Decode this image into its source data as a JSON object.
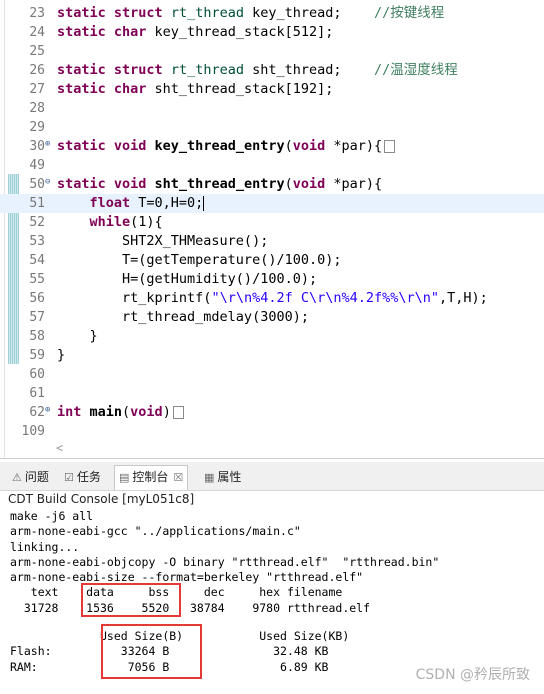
{
  "editor": {
    "lines": [
      {
        "n": "23",
        "parts": [
          {
            "t": "static ",
            "c": "kw"
          },
          {
            "t": "struct ",
            "c": "kw"
          },
          {
            "t": "rt_thread",
            "c": "ty"
          },
          {
            "t": " key_thread;    ",
            "c": ""
          },
          {
            "t": "//按键线程",
            "c": "cm"
          }
        ]
      },
      {
        "n": "24",
        "parts": [
          {
            "t": "static ",
            "c": "kw"
          },
          {
            "t": "char",
            "c": "kw"
          },
          {
            "t": " key_thread_stack[512];",
            "c": ""
          }
        ]
      },
      {
        "n": "25",
        "parts": []
      },
      {
        "n": "26",
        "parts": [
          {
            "t": "static ",
            "c": "kw"
          },
          {
            "t": "struct ",
            "c": "kw"
          },
          {
            "t": "rt_thread",
            "c": "ty"
          },
          {
            "t": " sht_thread;    ",
            "c": ""
          },
          {
            "t": "//温湿度线程",
            "c": "cm"
          }
        ]
      },
      {
        "n": "27",
        "parts": [
          {
            "t": "static ",
            "c": "kw"
          },
          {
            "t": "char",
            "c": "kw"
          },
          {
            "t": " sht_thread_stack[192];",
            "c": ""
          }
        ]
      },
      {
        "n": "28",
        "parts": []
      },
      {
        "n": "29",
        "parts": []
      },
      {
        "n": "30",
        "fold": "⊕",
        "collapsed": true,
        "parts": [
          {
            "t": "static ",
            "c": "kw"
          },
          {
            "t": "void ",
            "c": "kw"
          },
          {
            "t": "key_thread_entry",
            "c": "b"
          },
          {
            "t": "(",
            "c": ""
          },
          {
            "t": "void",
            "c": "kw"
          },
          {
            "t": " *par){",
            "c": ""
          }
        ]
      },
      {
        "n": "49",
        "parts": []
      },
      {
        "n": "50",
        "fold": "⊖",
        "parts": [
          {
            "t": "static ",
            "c": "kw"
          },
          {
            "t": "void ",
            "c": "kw"
          },
          {
            "t": "sht_thread_entry",
            "c": "b"
          },
          {
            "t": "(",
            "c": ""
          },
          {
            "t": "void",
            "c": "kw"
          },
          {
            "t": " *par){",
            "c": ""
          }
        ]
      },
      {
        "n": "51",
        "current": true,
        "caret": true,
        "parts": [
          {
            "t": "    ",
            "c": ""
          },
          {
            "t": "float",
            "c": "kw"
          },
          {
            "t": " T=0,H=0;",
            "c": ""
          }
        ]
      },
      {
        "n": "52",
        "parts": [
          {
            "t": "    ",
            "c": ""
          },
          {
            "t": "while",
            "c": "kw"
          },
          {
            "t": "(1){",
            "c": ""
          }
        ]
      },
      {
        "n": "53",
        "parts": [
          {
            "t": "        SHT2X_THMeasure();",
            "c": ""
          }
        ]
      },
      {
        "n": "54",
        "parts": [
          {
            "t": "        T=(getTemperature()/100.0);",
            "c": ""
          }
        ]
      },
      {
        "n": "55",
        "parts": [
          {
            "t": "        H=(getHumidity()/100.0);",
            "c": ""
          }
        ]
      },
      {
        "n": "56",
        "parts": [
          {
            "t": "        rt_kprintf(",
            "c": ""
          },
          {
            "t": "\"\\r\\n%4.2f C\\r\\n%4.2f%%\\r\\n\"",
            "c": "st"
          },
          {
            "t": ",T,H);",
            "c": ""
          }
        ]
      },
      {
        "n": "57",
        "parts": [
          {
            "t": "        rt_thread_mdelay(3000);",
            "c": ""
          }
        ]
      },
      {
        "n": "58",
        "parts": [
          {
            "t": "    }",
            "c": ""
          }
        ]
      },
      {
        "n": "59",
        "parts": [
          {
            "t": "}",
            "c": ""
          }
        ]
      },
      {
        "n": "60",
        "parts": []
      },
      {
        "n": "61",
        "parts": []
      },
      {
        "n": "62",
        "fold": "⊕",
        "collapsed": true,
        "parts": [
          {
            "t": "int ",
            "c": "kw"
          },
          {
            "t": "main",
            "c": "b"
          },
          {
            "t": "(",
            "c": ""
          },
          {
            "t": "void",
            "c": "kw"
          },
          {
            "t": ")",
            "c": ""
          }
        ]
      },
      {
        "n": "109",
        "parts": []
      }
    ],
    "hscroll_glyph": "<"
  },
  "panel": {
    "tabs": [
      {
        "label": "问题",
        "icon": "problems-icon",
        "glyph": "⚠"
      },
      {
        "label": "任务",
        "icon": "tasks-icon",
        "glyph": "☑"
      },
      {
        "label": "控制台",
        "icon": "console-icon",
        "glyph": "▤",
        "close": "☒"
      },
      {
        "label": "属性",
        "icon": "properties-icon",
        "glyph": "▦"
      }
    ],
    "console_title": "CDT Build Console [myL051c8]",
    "console_lines": [
      "make -j6 all",
      "arm-none-eabi-gcc \"../applications/main.c\"",
      "linking...",
      "arm-none-eabi-objcopy -O binary \"rtthread.elf\"  \"rtthread.bin\"",
      "arm-none-eabi-size --format=berkeley \"rtthread.elf\"",
      "   text    data     bss     dec     hex filename",
      "  31728    1536    5520   38784    9780 rtthread.elf",
      "",
      "             Used Size(B)           Used Size(KB)",
      "Flash:          33264 B               32.48 KB",
      "RAM:             7056 B                6.89 KB"
    ]
  },
  "watermark": "CSDN @矜辰所致",
  "colors": {
    "highlight_box": "#e53935",
    "keyword": "#7f0055",
    "type": "#005032",
    "comment": "#3f7f5f",
    "string": "#2a00ff"
  }
}
